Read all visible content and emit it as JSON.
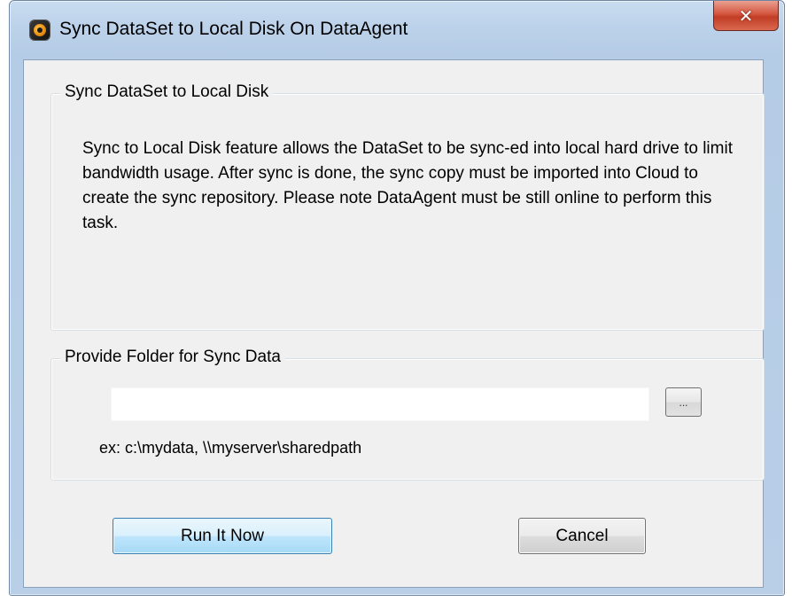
{
  "window": {
    "title": "Sync DataSet to Local Disk On DataAgent",
    "app_icon": "dataagent-app-icon",
    "close_icon": "close-x-icon",
    "close_glyph": "✕"
  },
  "description_group": {
    "label": "Sync DataSet to Local Disk",
    "text": "Sync to Local Disk feature allows the DataSet to be sync-ed into local hard drive to limit bandwidth usage. After sync is done, the sync copy must be imported into Cloud to create the sync repository. Please note DataAgent must be still online to perform this task."
  },
  "folder_group": {
    "label": "Provide Folder for Sync Data",
    "input_value": "",
    "input_placeholder": "",
    "browse_label": "...",
    "hint": "ex: c:\\mydata, \\\\myserver\\sharedpath"
  },
  "actions": {
    "run_label": "Run It Now",
    "cancel_label": "Cancel"
  },
  "colors": {
    "title_bar": "#bcd2ea",
    "client_background": "#f0f0f0",
    "close_button": "#c23d25",
    "default_button": "#bee6fd"
  }
}
